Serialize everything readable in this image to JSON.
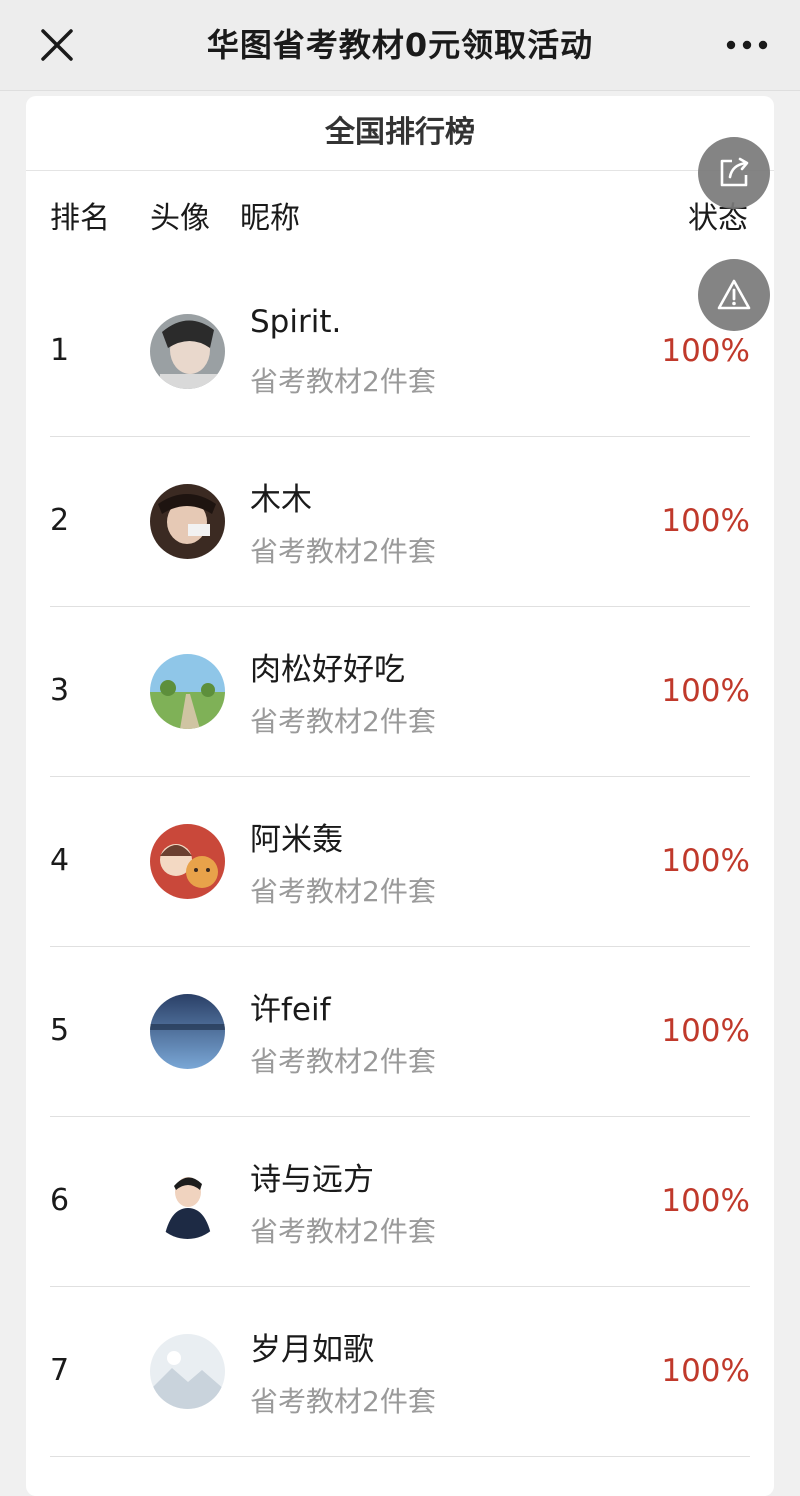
{
  "nav": {
    "title": "华图省考教材0元领取活动",
    "close_icon": "close-icon",
    "more_icon": "more-dots-icon"
  },
  "board": {
    "title": "全国排行榜",
    "headers": {
      "rank": "排名",
      "avatar": "头像",
      "nickname": "昵称",
      "status": "状态"
    }
  },
  "rows": [
    {
      "rank": "1",
      "nickname": "Spirit.",
      "subtitle": "省考教材2件套",
      "status": "100%"
    },
    {
      "rank": "2",
      "nickname": "木木",
      "subtitle": "省考教材2件套",
      "status": "100%"
    },
    {
      "rank": "3",
      "nickname": "肉松好好吃",
      "subtitle": "省考教材2件套",
      "status": "100%"
    },
    {
      "rank": "4",
      "nickname": "阿米轰",
      "subtitle": "省考教材2件套",
      "status": "100%"
    },
    {
      "rank": "5",
      "nickname": "许feif",
      "subtitle": "省考教材2件套",
      "status": "100%"
    },
    {
      "rank": "6",
      "nickname": "诗与远方",
      "subtitle": "省考教材2件套",
      "status": "100%"
    },
    {
      "rank": "7",
      "nickname": "岁月如歌",
      "subtitle": "省考教材2件套",
      "status": "100%"
    }
  ],
  "floating": {
    "share_icon": "share-icon",
    "report_icon": "warning-icon"
  },
  "colors": {
    "status": "#c0392b",
    "subtitle": "#9a9a9a"
  }
}
